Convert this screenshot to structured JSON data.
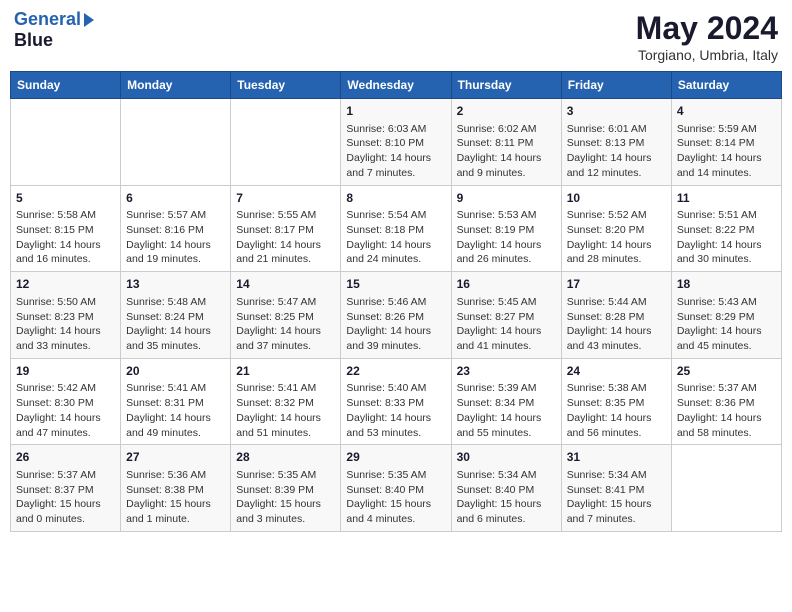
{
  "header": {
    "logo_line1": "General",
    "logo_line2": "Blue",
    "title": "May 2024",
    "subtitle": "Torgiano, Umbria, Italy"
  },
  "days_of_week": [
    "Sunday",
    "Monday",
    "Tuesday",
    "Wednesday",
    "Thursday",
    "Friday",
    "Saturday"
  ],
  "weeks": [
    [
      {
        "day": "",
        "info": ""
      },
      {
        "day": "",
        "info": ""
      },
      {
        "day": "",
        "info": ""
      },
      {
        "day": "1",
        "info": "Sunrise: 6:03 AM\nSunset: 8:10 PM\nDaylight: 14 hours\nand 7 minutes."
      },
      {
        "day": "2",
        "info": "Sunrise: 6:02 AM\nSunset: 8:11 PM\nDaylight: 14 hours\nand 9 minutes."
      },
      {
        "day": "3",
        "info": "Sunrise: 6:01 AM\nSunset: 8:13 PM\nDaylight: 14 hours\nand 12 minutes."
      },
      {
        "day": "4",
        "info": "Sunrise: 5:59 AM\nSunset: 8:14 PM\nDaylight: 14 hours\nand 14 minutes."
      }
    ],
    [
      {
        "day": "5",
        "info": "Sunrise: 5:58 AM\nSunset: 8:15 PM\nDaylight: 14 hours\nand 16 minutes."
      },
      {
        "day": "6",
        "info": "Sunrise: 5:57 AM\nSunset: 8:16 PM\nDaylight: 14 hours\nand 19 minutes."
      },
      {
        "day": "7",
        "info": "Sunrise: 5:55 AM\nSunset: 8:17 PM\nDaylight: 14 hours\nand 21 minutes."
      },
      {
        "day": "8",
        "info": "Sunrise: 5:54 AM\nSunset: 8:18 PM\nDaylight: 14 hours\nand 24 minutes."
      },
      {
        "day": "9",
        "info": "Sunrise: 5:53 AM\nSunset: 8:19 PM\nDaylight: 14 hours\nand 26 minutes."
      },
      {
        "day": "10",
        "info": "Sunrise: 5:52 AM\nSunset: 8:20 PM\nDaylight: 14 hours\nand 28 minutes."
      },
      {
        "day": "11",
        "info": "Sunrise: 5:51 AM\nSunset: 8:22 PM\nDaylight: 14 hours\nand 30 minutes."
      }
    ],
    [
      {
        "day": "12",
        "info": "Sunrise: 5:50 AM\nSunset: 8:23 PM\nDaylight: 14 hours\nand 33 minutes."
      },
      {
        "day": "13",
        "info": "Sunrise: 5:48 AM\nSunset: 8:24 PM\nDaylight: 14 hours\nand 35 minutes."
      },
      {
        "day": "14",
        "info": "Sunrise: 5:47 AM\nSunset: 8:25 PM\nDaylight: 14 hours\nand 37 minutes."
      },
      {
        "day": "15",
        "info": "Sunrise: 5:46 AM\nSunset: 8:26 PM\nDaylight: 14 hours\nand 39 minutes."
      },
      {
        "day": "16",
        "info": "Sunrise: 5:45 AM\nSunset: 8:27 PM\nDaylight: 14 hours\nand 41 minutes."
      },
      {
        "day": "17",
        "info": "Sunrise: 5:44 AM\nSunset: 8:28 PM\nDaylight: 14 hours\nand 43 minutes."
      },
      {
        "day": "18",
        "info": "Sunrise: 5:43 AM\nSunset: 8:29 PM\nDaylight: 14 hours\nand 45 minutes."
      }
    ],
    [
      {
        "day": "19",
        "info": "Sunrise: 5:42 AM\nSunset: 8:30 PM\nDaylight: 14 hours\nand 47 minutes."
      },
      {
        "day": "20",
        "info": "Sunrise: 5:41 AM\nSunset: 8:31 PM\nDaylight: 14 hours\nand 49 minutes."
      },
      {
        "day": "21",
        "info": "Sunrise: 5:41 AM\nSunset: 8:32 PM\nDaylight: 14 hours\nand 51 minutes."
      },
      {
        "day": "22",
        "info": "Sunrise: 5:40 AM\nSunset: 8:33 PM\nDaylight: 14 hours\nand 53 minutes."
      },
      {
        "day": "23",
        "info": "Sunrise: 5:39 AM\nSunset: 8:34 PM\nDaylight: 14 hours\nand 55 minutes."
      },
      {
        "day": "24",
        "info": "Sunrise: 5:38 AM\nSunset: 8:35 PM\nDaylight: 14 hours\nand 56 minutes."
      },
      {
        "day": "25",
        "info": "Sunrise: 5:37 AM\nSunset: 8:36 PM\nDaylight: 14 hours\nand 58 minutes."
      }
    ],
    [
      {
        "day": "26",
        "info": "Sunrise: 5:37 AM\nSunset: 8:37 PM\nDaylight: 15 hours\nand 0 minutes."
      },
      {
        "day": "27",
        "info": "Sunrise: 5:36 AM\nSunset: 8:38 PM\nDaylight: 15 hours\nand 1 minute."
      },
      {
        "day": "28",
        "info": "Sunrise: 5:35 AM\nSunset: 8:39 PM\nDaylight: 15 hours\nand 3 minutes."
      },
      {
        "day": "29",
        "info": "Sunrise: 5:35 AM\nSunset: 8:40 PM\nDaylight: 15 hours\nand 4 minutes."
      },
      {
        "day": "30",
        "info": "Sunrise: 5:34 AM\nSunset: 8:40 PM\nDaylight: 15 hours\nand 6 minutes."
      },
      {
        "day": "31",
        "info": "Sunrise: 5:34 AM\nSunset: 8:41 PM\nDaylight: 15 hours\nand 7 minutes."
      },
      {
        "day": "",
        "info": ""
      }
    ]
  ]
}
